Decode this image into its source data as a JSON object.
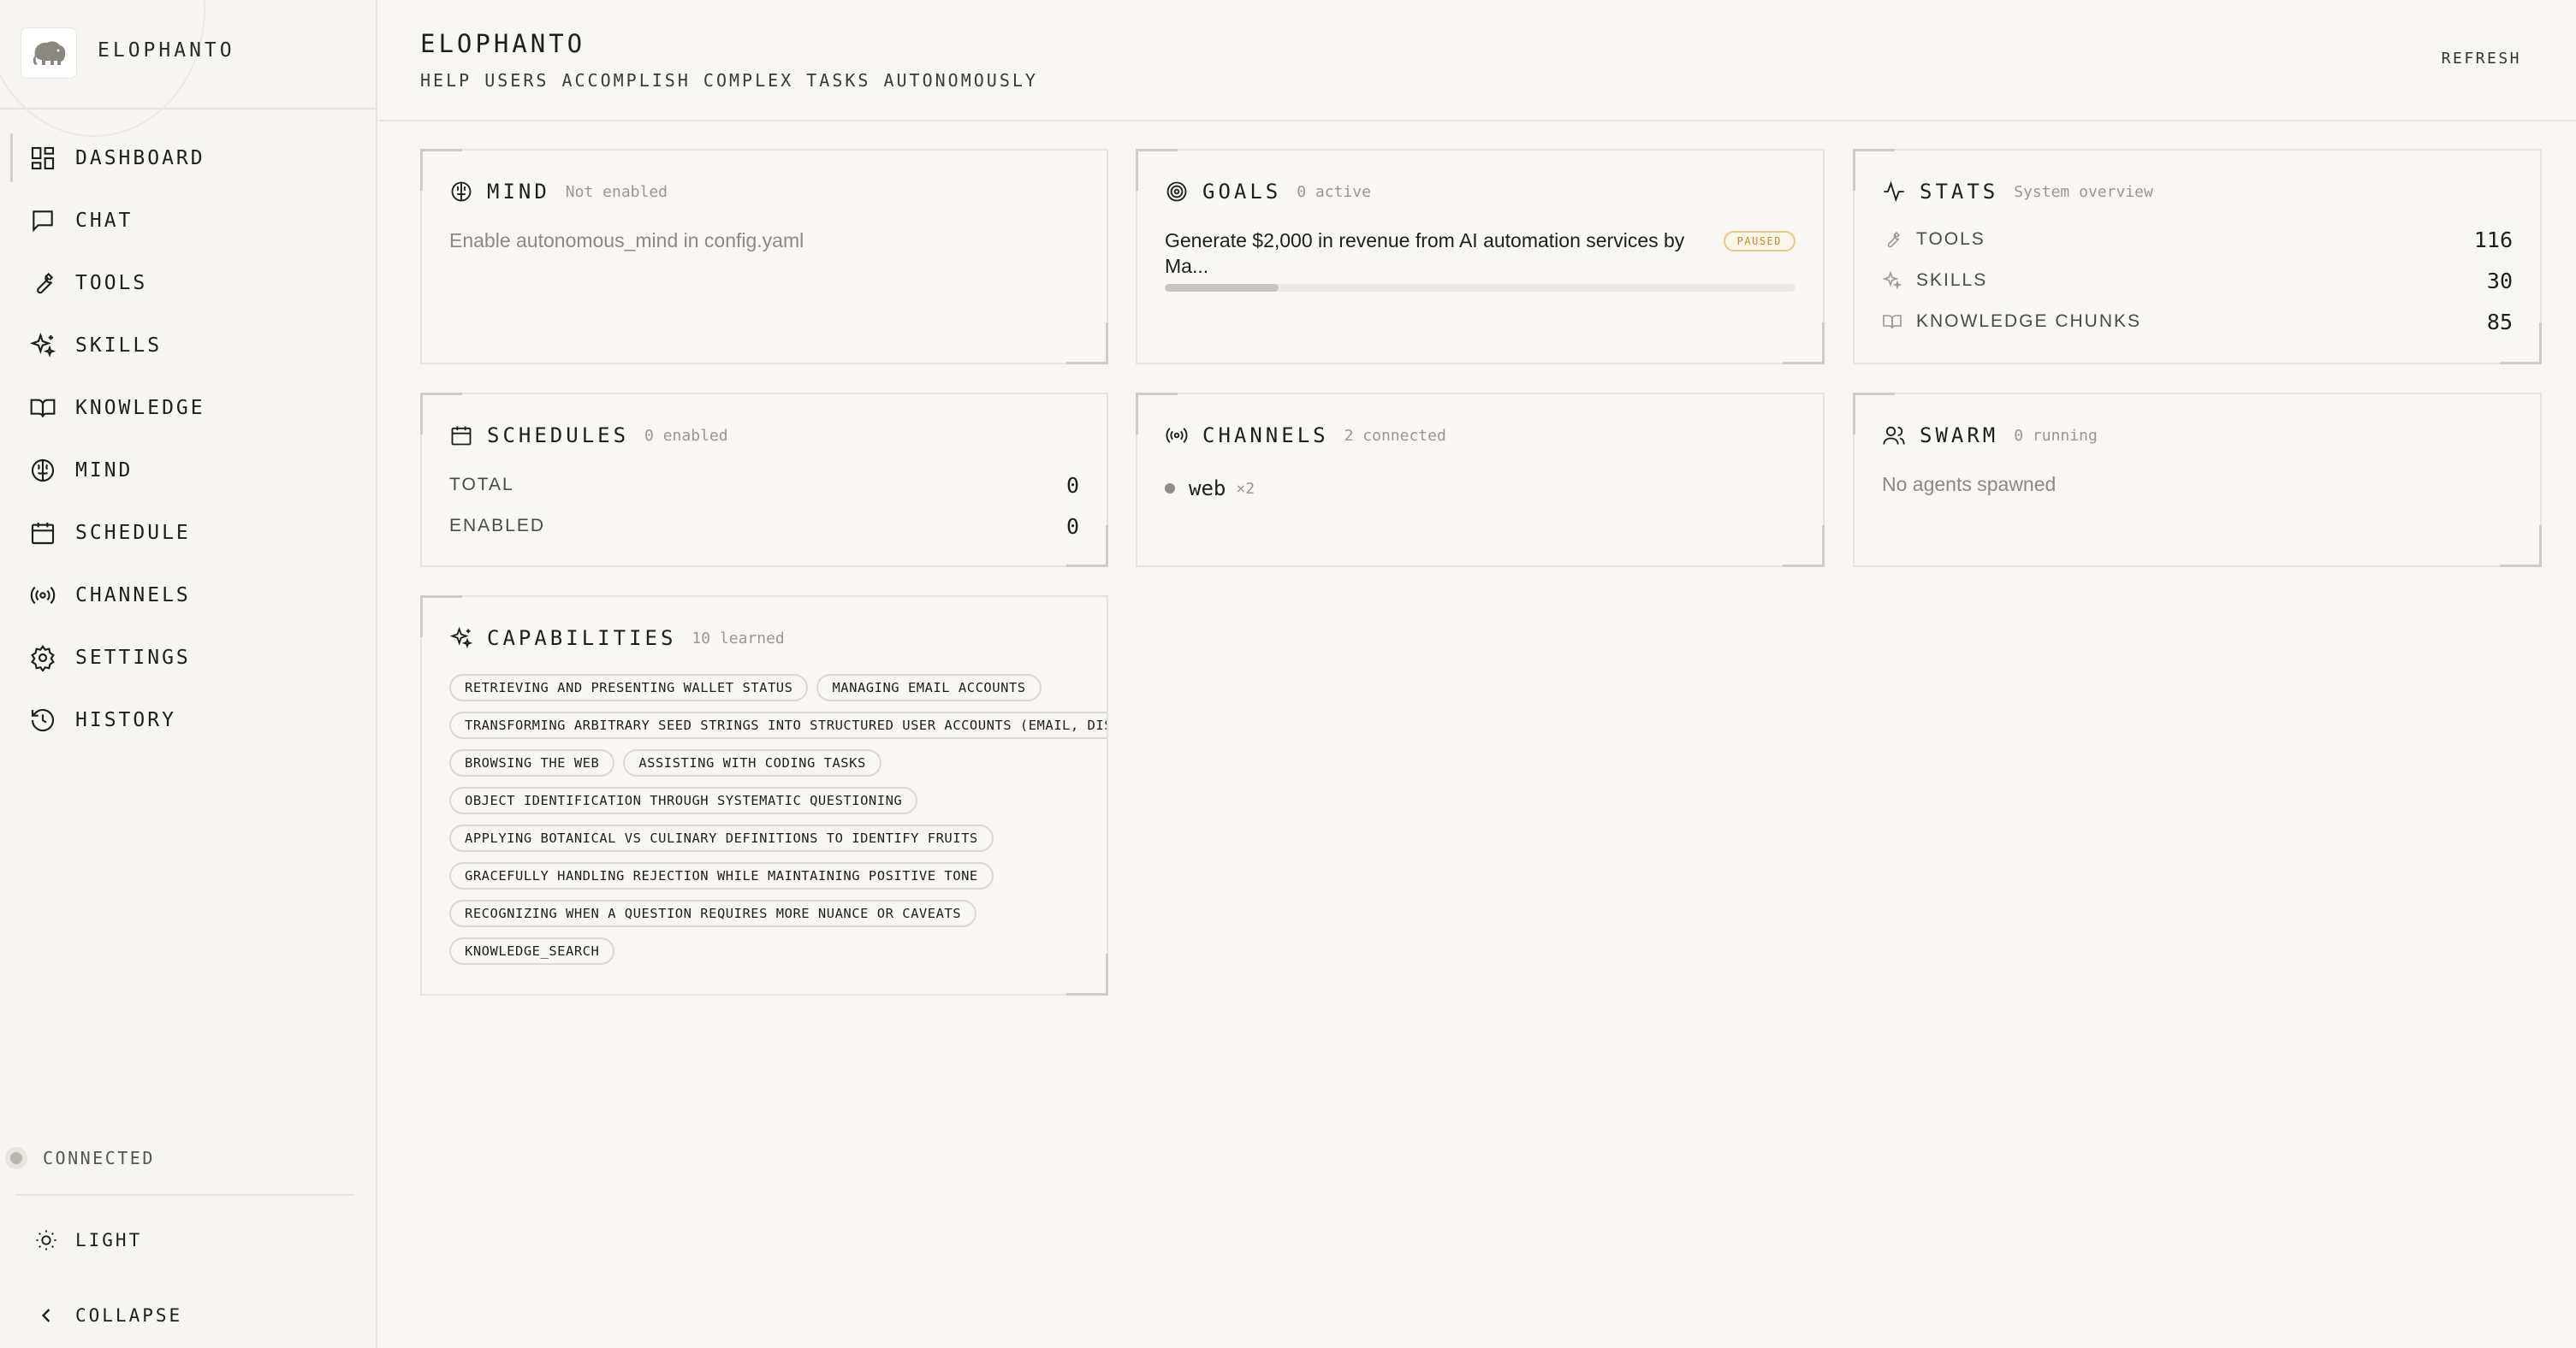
{
  "app": {
    "brand": "ELOPHANTO",
    "title": "ELOPHANTO",
    "subtitle": "HELP USERS ACCOMPLISH COMPLEX TASKS AUTONOMOUSLY",
    "refresh_label": "REFRESH"
  },
  "sidebar": {
    "items": [
      {
        "label": "DASHBOARD",
        "icon": "dashboard-icon",
        "active": true
      },
      {
        "label": "CHAT",
        "icon": "chat-icon"
      },
      {
        "label": "TOOLS",
        "icon": "wrench-icon"
      },
      {
        "label": "SKILLS",
        "icon": "sparkles-icon"
      },
      {
        "label": "KNOWLEDGE",
        "icon": "book-icon"
      },
      {
        "label": "MIND",
        "icon": "brain-icon"
      },
      {
        "label": "SCHEDULE",
        "icon": "calendar-icon"
      },
      {
        "label": "CHANNELS",
        "icon": "broadcast-icon"
      },
      {
        "label": "SETTINGS",
        "icon": "gear-icon"
      },
      {
        "label": "HISTORY",
        "icon": "history-icon"
      }
    ],
    "connection": "CONNECTED",
    "theme_label": "LIGHT",
    "collapse_label": "COLLAPSE"
  },
  "cards": {
    "mind": {
      "title": "MIND",
      "sub": "Not enabled",
      "body": "Enable autonomous_mind in config.yaml"
    },
    "goals": {
      "title": "GOALS",
      "sub": "0 active",
      "goal": "Generate $2,000 in revenue from AI automation services by Ma...",
      "status": "PAUSED",
      "progress_pct": 18
    },
    "stats": {
      "title": "STATS",
      "sub": "System overview",
      "rows": [
        {
          "label": "TOOLS",
          "value": "116",
          "icon": "wrench-icon"
        },
        {
          "label": "SKILLS",
          "value": "30",
          "icon": "sparkles-icon"
        },
        {
          "label": "KNOWLEDGE CHUNKS",
          "value": "85",
          "icon": "book-icon"
        }
      ]
    },
    "schedules": {
      "title": "SCHEDULES",
      "sub": "0 enabled",
      "rows": [
        {
          "label": "TOTAL",
          "value": "0"
        },
        {
          "label": "ENABLED",
          "value": "0"
        }
      ]
    },
    "channels": {
      "title": "CHANNELS",
      "sub": "2 connected",
      "items": [
        {
          "name": "web",
          "count": "×2"
        }
      ]
    },
    "swarm": {
      "title": "SWARM",
      "sub": "0 running",
      "body": "No agents spawned"
    },
    "capabilities": {
      "title": "CAPABILITIES",
      "sub": "10 learned",
      "lines": [
        [
          "RETRIEVING AND PRESENTING WALLET STATUS",
          "MANAGING EMAIL ACCOUNTS"
        ],
        [
          "TRANSFORMING ARBITRARY SEED STRINGS INTO STRUCTURED USER ACCOUNTS (EMAIL, DISPLAY NAME)"
        ],
        [
          "BROWSING THE WEB",
          "ASSISTING WITH CODING TASKS"
        ],
        [
          "OBJECT IDENTIFICATION THROUGH SYSTEMATIC QUESTIONING"
        ],
        [
          "APPLYING BOTANICAL VS CULINARY DEFINITIONS TO IDENTIFY FRUITS"
        ],
        [
          "GRACEFULLY HANDLING REJECTION WHILE MAINTAINING POSITIVE TONE"
        ],
        [
          "RECOGNIZING WHEN A QUESTION REQUIRES MORE NUANCE OR CAVEATS"
        ],
        [
          "KNOWLEDGE_SEARCH"
        ]
      ]
    }
  },
  "colors": {
    "accent_paused": "#c98b19",
    "border": "#e6e4df",
    "background": "#f7f6f3"
  }
}
